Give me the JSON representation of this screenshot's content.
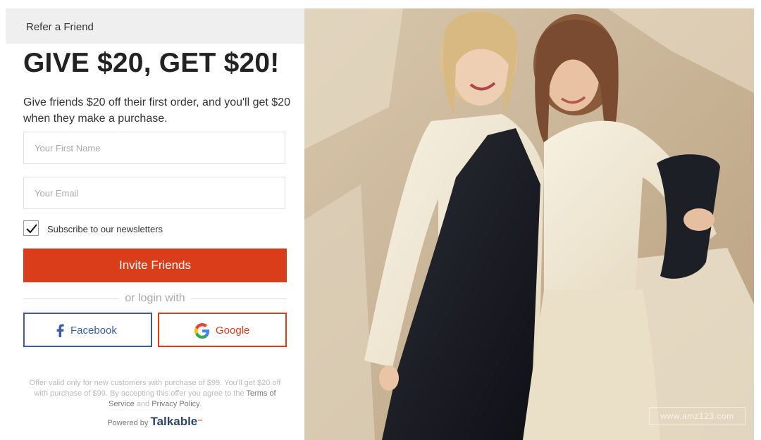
{
  "tabs": {
    "refer": "Refer a Friend"
  },
  "offer": {
    "headline": "GIVE $20, GET $20!",
    "subtext": "Give friends $20 off their first order, and you'll get $20 when they make a purchase."
  },
  "form": {
    "first_name_placeholder": "Your First Name",
    "first_name_value": "",
    "email_placeholder": "Your Email",
    "email_value": "",
    "subscribe_label": "Subscribe to our newsletters",
    "subscribe_checked": true,
    "invite_label": "Invite Friends"
  },
  "login": {
    "divider": "or login with",
    "facebook": "Facebook",
    "google": "Google"
  },
  "fine_print": {
    "text_1": "Offer valid only for new customers with purchase of $99. You'll get $20 off with purchase of $99. By accepting this offer you agree to the",
    "terms": "Terms of Service",
    "and": "and",
    "privacy": "Privacy Policy",
    "end": "."
  },
  "powered": {
    "prefix": "Powered by",
    "brand": "Talkable"
  },
  "photo": {
    "watermark": "www.amz123.com"
  },
  "colors": {
    "accent": "#d93d19",
    "facebook": "#3b5ba5",
    "tab_bg": "#efefef"
  },
  "icons": [
    "check-icon",
    "facebook-icon",
    "google-icon",
    "talkable-logo-mark"
  ]
}
